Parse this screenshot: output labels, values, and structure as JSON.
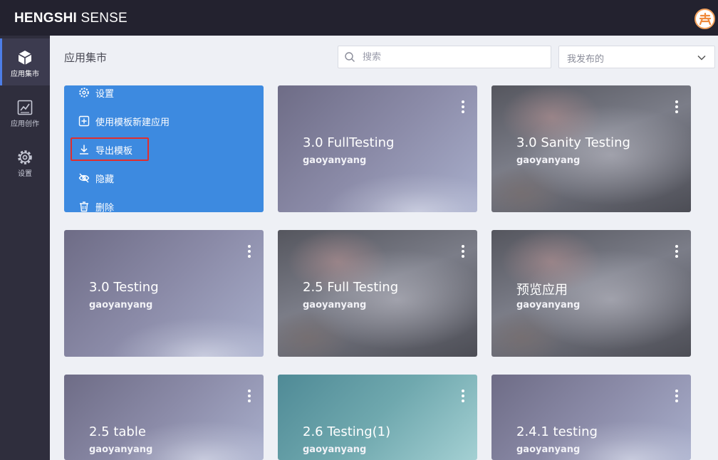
{
  "header": {
    "brand_bold": "HENGSHI",
    "brand_rest": " SENSE"
  },
  "sidebar": {
    "items": [
      {
        "label": "应用集市",
        "icon": "cube-icon",
        "active": true
      },
      {
        "label": "应用创作",
        "icon": "chart-line-icon",
        "active": false
      },
      {
        "label": "设置",
        "icon": "gear-icon",
        "active": false
      }
    ]
  },
  "main": {
    "title": "应用集市",
    "search": {
      "placeholder": "搜索",
      "value": ""
    },
    "filter": {
      "selected": "我发布的"
    }
  },
  "context_menu": {
    "items": [
      {
        "label": "设置",
        "icon": "gear-icon"
      },
      {
        "label": "使用模板新建应用",
        "icon": "plus-box-icon"
      },
      {
        "label": "导出模板",
        "icon": "download-icon",
        "highlighted": true
      },
      {
        "label": "隐藏",
        "icon": "eye-off-icon"
      },
      {
        "label": "删除",
        "icon": "trash-icon"
      }
    ]
  },
  "cards": [
    {
      "title": "3.0 FullTesting",
      "author": "gaoyanyang"
    },
    {
      "title": "3.0 Sanity Testing",
      "author": "gaoyanyang"
    },
    {
      "title": "3.0 Testing",
      "author": "gaoyanyang"
    },
    {
      "title": "2.5 Full Testing",
      "author": "gaoyanyang"
    },
    {
      "title": "预览应用",
      "author": "gaoyanyang"
    },
    {
      "title": "2.5 table",
      "author": "gaoyanyang"
    },
    {
      "title": "2.6 Testing(1)",
      "author": "gaoyanyang"
    },
    {
      "title": "2.4.1 testing",
      "author": "gaoyanyang"
    }
  ],
  "colors": {
    "topbar": "#23222f",
    "sidebar": "#2f2e3d",
    "menu_card": "#3d8ae0",
    "highlight": "#e02e2e",
    "accent": "#4d7ee8"
  }
}
